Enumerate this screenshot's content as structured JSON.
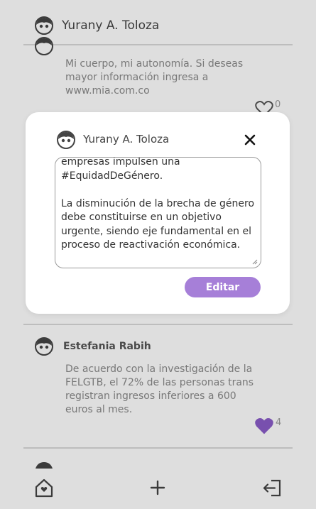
{
  "header": {
    "user_name": "Yurany A. Toloza"
  },
  "feed": {
    "post1": {
      "text_lines": [
        "Mi cuerpo, mi autonomía. Si deseas",
        "mayor información ingresa a",
        "www.mia.com.co"
      ],
      "like_count": "0"
    },
    "post2": {
      "author": "Estefania Rabih",
      "text_lines": [
        "De acuerdo con la investigación de la",
        "FELGTB, el 72% de las personas trans",
        "registran ingresos inferiores a 600",
        "euros al mes."
      ],
      "like_count": "4"
    }
  },
  "modal": {
    "user_name": "Yurany A. Toloza",
    "editor_text": "empresas impulsen una\n#EquidadDeGénero.\n\nLa disminución de la brecha de género debe constituirse en un objetivo urgente, siendo eje fundamental en el proceso de reactivación económica.",
    "edit_button_label": "Editar"
  },
  "colors": {
    "accent": "#a67fd8",
    "heart_filled": "#8a5cc8"
  },
  "icons": {
    "home": "home-icon",
    "add": "plus-icon",
    "logout": "logout-icon",
    "close": "close-icon",
    "like": "heart-icon"
  }
}
